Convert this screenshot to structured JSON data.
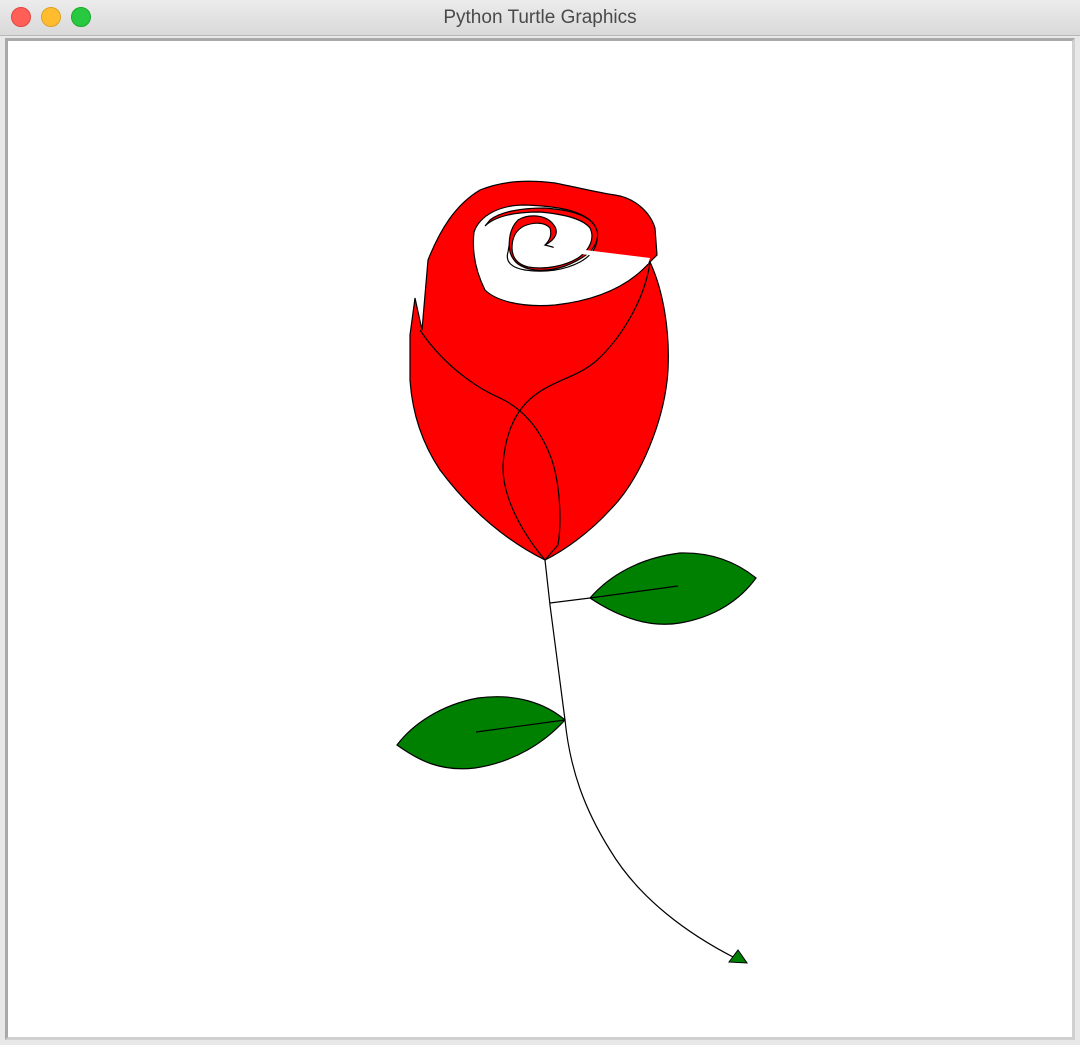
{
  "window": {
    "title": "Python Turtle Graphics"
  },
  "buttons": {
    "close": "close-button",
    "minimize": "minimize-button",
    "zoom": "zoom-button"
  },
  "colors": {
    "petal": "#ff0000",
    "leaf": "#008000",
    "stroke": "#000000",
    "background": "#ffffff",
    "turtle": "#008000"
  },
  "drawing": {
    "subject": "rose",
    "parts": [
      "bloom",
      "stem",
      "upper-leaf",
      "lower-leaf",
      "turtle-cursor"
    ]
  }
}
